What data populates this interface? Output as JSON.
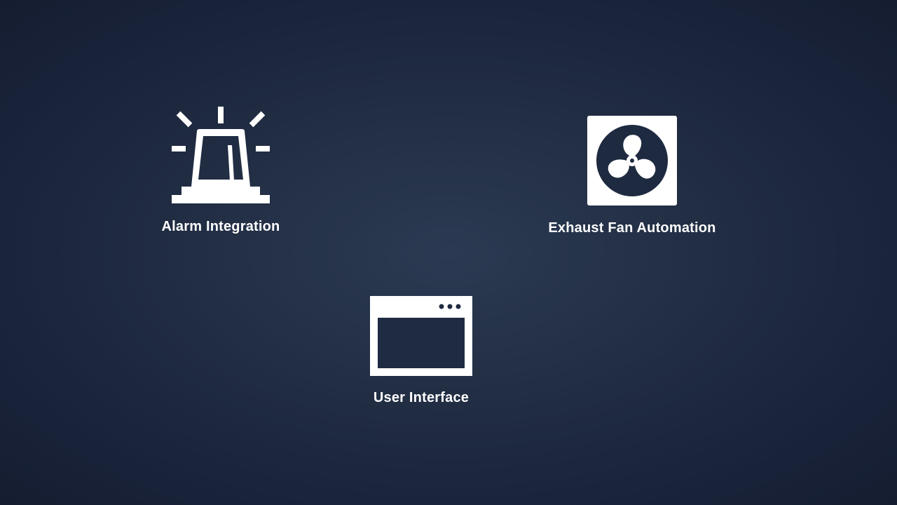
{
  "features": {
    "alarm": {
      "label": "Alarm Integration",
      "icon": "siren-icon"
    },
    "fan": {
      "label": "Exhaust Fan Automation",
      "icon": "exhaust-fan-icon"
    },
    "ui": {
      "label": "User Interface",
      "icon": "browser-window-icon"
    }
  },
  "colors": {
    "background_center": "#2b3a52",
    "background_edge": "#151d30",
    "foreground": "#ffffff"
  }
}
